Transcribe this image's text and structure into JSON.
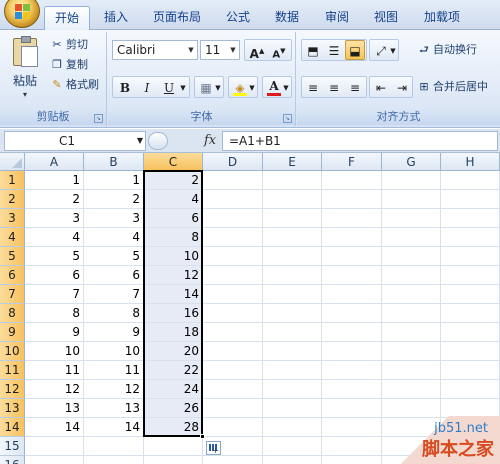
{
  "ribbon": {
    "tabs": [
      "开始",
      "插入",
      "页面布局",
      "公式",
      "数据",
      "审阅",
      "视图",
      "加载项"
    ],
    "active_tab": "开始",
    "clipboard": {
      "paste_label": "粘贴",
      "cut_label": "剪切",
      "copy_label": "复制",
      "format_painter_label": "格式刷",
      "group_label": "剪贴板"
    },
    "font": {
      "font_name": "Calibri",
      "font_size": "11",
      "grow_label": "A",
      "shrink_label": "A",
      "bold_label": "B",
      "italic_label": "I",
      "underline_label": "U",
      "font_color_label": "A",
      "group_label": "字体"
    },
    "alignment": {
      "wrap_text_label": "自动换行",
      "merge_center_label": "合并后居中",
      "group_label": "对齐方式"
    }
  },
  "formula_bar": {
    "name_box": "C1",
    "fx_label": "fx",
    "formula": "=A1+B1"
  },
  "sheet": {
    "columns": [
      "A",
      "B",
      "C",
      "D",
      "E",
      "F",
      "G",
      "H"
    ],
    "selected_column": "C",
    "rows": [
      {
        "num": "1",
        "a": "1",
        "b": "1",
        "c": "2"
      },
      {
        "num": "2",
        "a": "2",
        "b": "2",
        "c": "4"
      },
      {
        "num": "3",
        "a": "3",
        "b": "3",
        "c": "6"
      },
      {
        "num": "4",
        "a": "4",
        "b": "4",
        "c": "8"
      },
      {
        "num": "5",
        "a": "5",
        "b": "5",
        "c": "10"
      },
      {
        "num": "6",
        "a": "6",
        "b": "6",
        "c": "12"
      },
      {
        "num": "7",
        "a": "7",
        "b": "7",
        "c": "14"
      },
      {
        "num": "8",
        "a": "8",
        "b": "8",
        "c": "16"
      },
      {
        "num": "9",
        "a": "9",
        "b": "9",
        "c": "18"
      },
      {
        "num": "10",
        "a": "10",
        "b": "10",
        "c": "20"
      },
      {
        "num": "11",
        "a": "11",
        "b": "11",
        "c": "22"
      },
      {
        "num": "12",
        "a": "12",
        "b": "12",
        "c": "24"
      },
      {
        "num": "13",
        "a": "13",
        "b": "13",
        "c": "26"
      },
      {
        "num": "14",
        "a": "14",
        "b": "14",
        "c": "28"
      },
      {
        "num": "15",
        "a": "",
        "b": "",
        "c": ""
      },
      {
        "num": "16",
        "a": "",
        "b": "",
        "c": ""
      }
    ],
    "selected_rows_count": 14
  },
  "watermark": {
    "site": "jb51.net",
    "name": "脚本之家"
  },
  "colors": {
    "selection_header": "#f7c25c",
    "selection_fill": "#e6ebf5",
    "ribbon_text": "#15428b"
  }
}
